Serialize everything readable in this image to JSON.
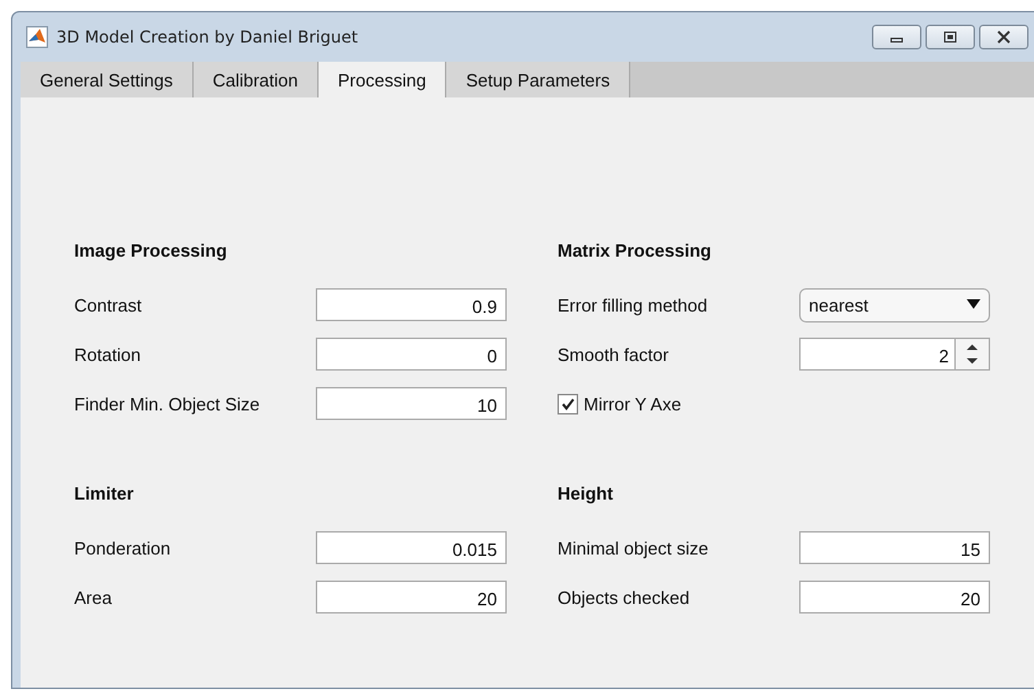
{
  "window": {
    "title": "3D Model Creation by Daniel Briguet"
  },
  "tabs": [
    {
      "label": "General Settings",
      "selected": false
    },
    {
      "label": "Calibration",
      "selected": false
    },
    {
      "label": "Processing",
      "selected": true
    },
    {
      "label": "Setup Parameters",
      "selected": false
    }
  ],
  "sections": [
    {
      "title": "Image Processing",
      "rows": [
        {
          "kind": "field",
          "label": "Contrast",
          "value": "0.9"
        },
        {
          "kind": "field",
          "label": "Rotation",
          "value": "0"
        },
        {
          "kind": "field",
          "label": "Finder Min. Object Size",
          "value": "10"
        }
      ]
    },
    {
      "title": "Matrix Processing",
      "rows": [
        {
          "kind": "dropdown",
          "label": "Error filling method",
          "value": "nearest"
        },
        {
          "kind": "spinner",
          "label": "Smooth factor",
          "value": "2"
        },
        {
          "kind": "checkbox",
          "label": "Mirror Y Axe",
          "checked": true
        }
      ]
    },
    {
      "title": "Limiter",
      "rows": [
        {
          "kind": "field",
          "label": "Ponderation",
          "value": "0.015"
        },
        {
          "kind": "field",
          "label": "Area",
          "value": "20"
        }
      ]
    },
    {
      "title": "Height",
      "rows": [
        {
          "kind": "field",
          "label": "Minimal object size",
          "value": "15"
        },
        {
          "kind": "field",
          "label": "Objects checked",
          "value": "20"
        }
      ]
    }
  ]
}
